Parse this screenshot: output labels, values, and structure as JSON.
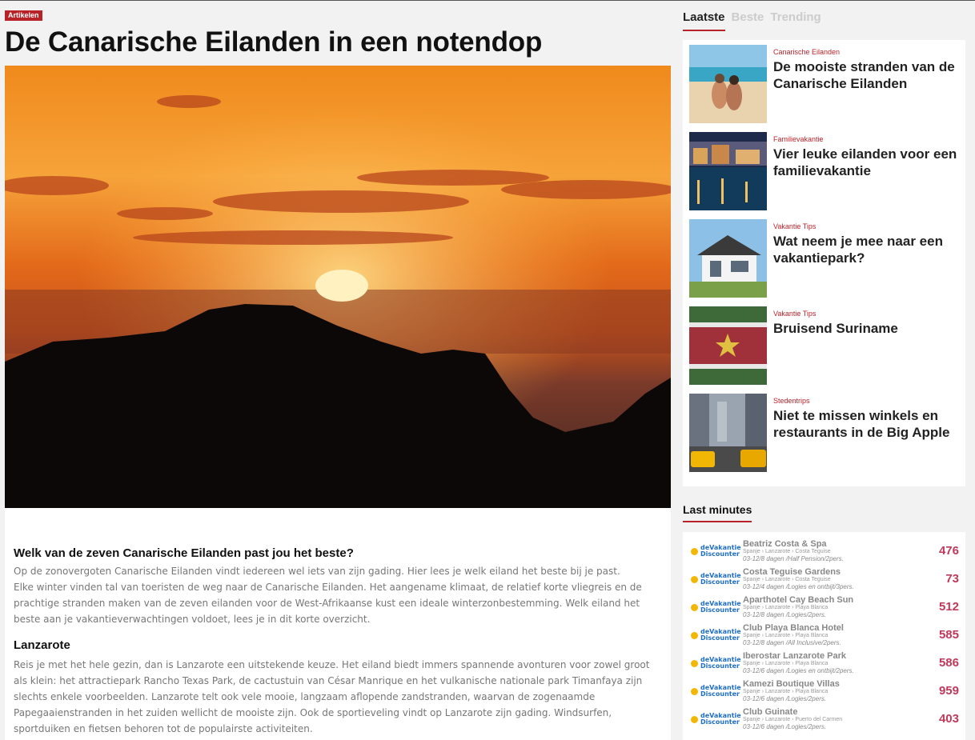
{
  "article": {
    "category_badge": "Artikelen",
    "title": "De Canarische Eilanden in een notendop",
    "intro_heading": "Welk van de zeven Canarische Eilanden past jou het beste?",
    "intro_p1": "Op de zonovergoten Canarische Eilanden vindt iedereen wel iets van zijn gading. Hier lees je welk eiland het beste bij je past.",
    "intro_p2": "Elke winter vinden tal van toeristen de weg naar de Canarische Eilanden. Het aangename klimaat, de relatief korte vliegreis en de prachtige stranden maken van de zeven eilanden voor de West-Afrikaanse kust een ideale winterzonbestemming. Welk eiland het beste aan je vakantieverwachtingen voldoet, lees je in dit korte overzicht.",
    "section_heading": "Lanzarote",
    "section_p": "Reis je met het hele gezin, dan is Lanzarote een uitstekende keuze. Het eiland biedt immers spannende avonturen voor zowel groot als klein: het attractiepark Rancho Texas Park, de cactustuin van César Manrique en het vulkanische nationale park Timanfaya zijn slechts enkele voorbeelden. Lanzarote telt ook vele mooie, langzaam aflopende zandstranden, waarvan de zogenaamde Papegaaienstranden in het zuiden wellicht de mooiste zijn. Ook de sportieveling vindt op Lanzarote zijn gading. Windsurfen, sportduiken en fietsen behoren tot de populairste activiteiten."
  },
  "sidebar": {
    "tabs": [
      {
        "label": "Laatste",
        "active": true
      },
      {
        "label": "Beste",
        "active": false
      },
      {
        "label": "Trending",
        "active": false
      }
    ],
    "posts": [
      {
        "category": "Canarische Eilanden",
        "title": "De mooiste stranden van de Canarische Eilanden",
        "thumb": "beach-couple"
      },
      {
        "category": "Familievakantie",
        "title": "Vier leuke eilanden voor een familievakantie",
        "thumb": "harbor-night"
      },
      {
        "category": "Vakantie Tips",
        "title": "Wat neem je mee naar een vakantiepark?",
        "thumb": "holiday-house"
      },
      {
        "category": "Vakantie Tips",
        "title": "Bruisend Suriname",
        "thumb": "suriname-flag"
      },
      {
        "category": "Stedentrips",
        "title": "Niet te missen winkels en restaurants in de Big Apple",
        "thumb": "new-york-street"
      }
    ],
    "last_minutes_title": "Last minutes",
    "logo_line1": "deVakantie",
    "logo_line2": "Discounter",
    "deals": [
      {
        "name": "Beatriz Costa & Spa",
        "location": "Spanje › Lanzarote › Costa Teguise",
        "dates": "03-12/8 dagen /Half Pension/2pers.",
        "price": "476"
      },
      {
        "name": "Costa Teguise Gardens",
        "location": "Spanje › Lanzarote › Costa Teguise",
        "dates": "03-12/4 dagen /Logies en ontbijt/3pers.",
        "price": "73"
      },
      {
        "name": "Aparthotel Cay Beach Sun",
        "location": "Spanje › Lanzarote › Playa Blanca",
        "dates": "03-12/8 dagen /Logies/2pers.",
        "price": "512"
      },
      {
        "name": "Club Playa Blanca Hotel",
        "location": "Spanje › Lanzarote › Playa Blanca",
        "dates": "03-12/8 dagen /All Inclusive/2pers.",
        "price": "585"
      },
      {
        "name": "Iberostar Lanzarote Park",
        "location": "Spanje › Lanzarote › Playa Blanca",
        "dates": "03-12/6 dagen /Logies en ontbijt/2pers.",
        "price": "586"
      },
      {
        "name": "Kamezi Boutique Villas",
        "location": "Spanje › Lanzarote › Playa Blanca",
        "dates": "03-12/6 dagen /Logies/2pers.",
        "price": "959"
      },
      {
        "name": "Club Guinate",
        "location": "Spanje › Lanzarote › Puerto del Carmen",
        "dates": "03-12/6 dagen /Logies/2pers.",
        "price": "403"
      }
    ]
  },
  "colors": {
    "accent": "#b8232a",
    "price": "#c0395a",
    "background": "#f2f2f2"
  }
}
